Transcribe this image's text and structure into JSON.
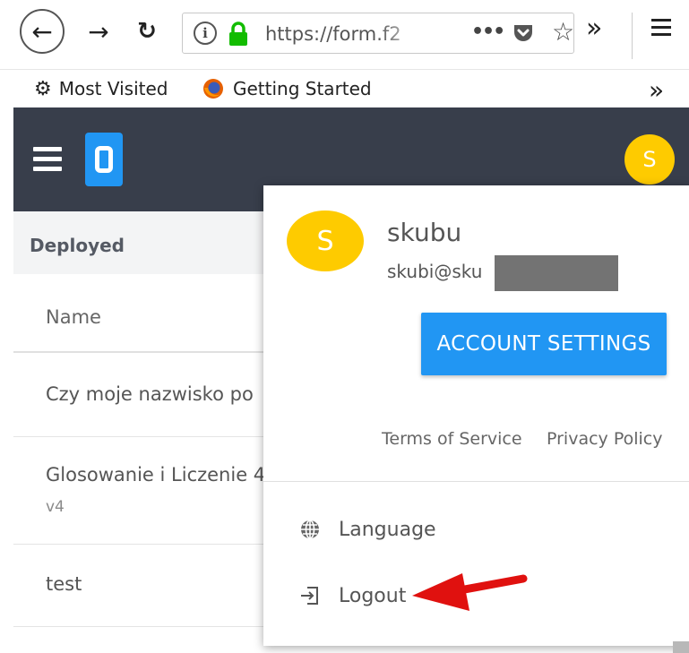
{
  "browser": {
    "url": "https://form.f2",
    "more_label": "•••",
    "overflow_label": "»",
    "bookmarks": [
      {
        "label": "Most Visited",
        "icon": "gear-icon"
      },
      {
        "label": "Getting Started",
        "icon": "firefox-icon"
      }
    ]
  },
  "header": {
    "avatar_letter": "S",
    "avatar_color": "#fecb00",
    "accent_color": "#2196f3",
    "bg_color": "#383e4b"
  },
  "main": {
    "section_title": "Deployed",
    "column_header": "Name",
    "rows": [
      {
        "name": "Czy moje nazwisko po",
        "version": ""
      },
      {
        "name": "Glosowanie i Liczenie 4",
        "version": "v4"
      },
      {
        "name": "test",
        "version": ""
      }
    ]
  },
  "account_menu": {
    "avatar_letter": "S",
    "username": "skubu",
    "email": "skubi@sku",
    "account_settings_label": "ACCOUNT SETTINGS",
    "terms_label": "Terms of Service",
    "privacy_label": "Privacy Policy",
    "language_label": "Language",
    "logout_label": "Logout"
  }
}
